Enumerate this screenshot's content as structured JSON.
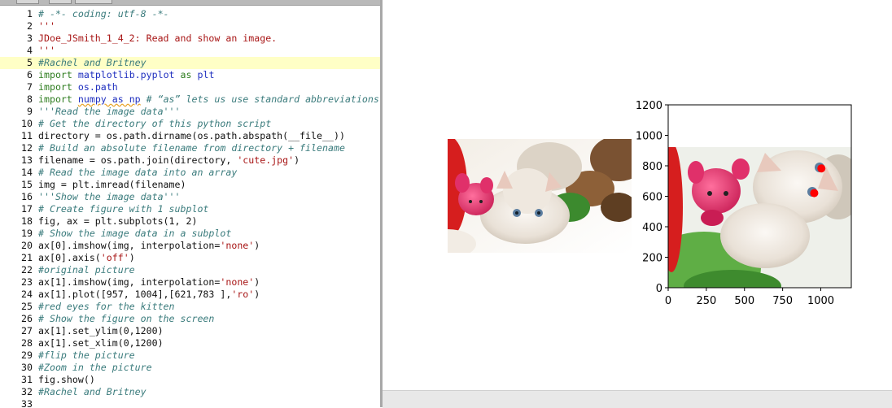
{
  "editor": {
    "highlighted_line": 5,
    "lines": [
      [
        {
          "c": "comment",
          "t": "# -*- coding: utf-8 -*-"
        }
      ],
      [
        {
          "c": "string",
          "t": "'''"
        }
      ],
      [
        {
          "c": "string",
          "t": "JDoe_JSmith_1_4_2: Read and show an image."
        }
      ],
      [
        {
          "c": "string",
          "t": "'''"
        }
      ],
      [
        {
          "c": "comment",
          "t": "#Rachel and Britney"
        }
      ],
      [
        {
          "c": "keyword",
          "t": "import"
        },
        {
          "c": "plain",
          "t": " "
        },
        {
          "c": "module",
          "t": "matplotlib.pyplot"
        },
        {
          "c": "plain",
          "t": " "
        },
        {
          "c": "keyword",
          "t": "as"
        },
        {
          "c": "plain",
          "t": " "
        },
        {
          "c": "module",
          "t": "plt"
        }
      ],
      [
        {
          "c": "keyword",
          "t": "import"
        },
        {
          "c": "plain",
          "t": " "
        },
        {
          "c": "module",
          "t": "os.path"
        }
      ],
      [
        {
          "c": "keyword",
          "t": "import"
        },
        {
          "c": "plain",
          "t": " "
        },
        {
          "c": "module squig",
          "t": "numpy as np"
        },
        {
          "c": "plain",
          "t": " "
        },
        {
          "c": "comment",
          "t": "# “as” lets us use standard abbreviations"
        }
      ],
      [
        {
          "c": "comment",
          "t": "'''Read the image data'''"
        }
      ],
      [
        {
          "c": "comment",
          "t": "# Get the directory of this python script"
        }
      ],
      [
        {
          "c": "plain",
          "t": "directory = os.path.dirname(os.path.abspath(__file__))"
        }
      ],
      [
        {
          "c": "comment",
          "t": "# Build an absolute filename from directory + filename"
        }
      ],
      [
        {
          "c": "plain",
          "t": "filename = os.path.join(directory, "
        },
        {
          "c": "string",
          "t": "'cute.jpg'"
        },
        {
          "c": "plain",
          "t": ")"
        }
      ],
      [
        {
          "c": "comment",
          "t": "# Read the image data into an array"
        }
      ],
      [
        {
          "c": "plain",
          "t": "img = plt.imread(filename)"
        }
      ],
      [
        {
          "c": "comment",
          "t": "'''Show the image data'''"
        }
      ],
      [
        {
          "c": "comment",
          "t": "# Create figure with 1 subplot"
        }
      ],
      [
        {
          "c": "plain",
          "t": "fig, ax = plt.subplots(1, 2)"
        }
      ],
      [
        {
          "c": "comment",
          "t": "# Show the image data in a subplot"
        }
      ],
      [
        {
          "c": "plain",
          "t": "ax[0].imshow(img, interpolation="
        },
        {
          "c": "string",
          "t": "'none'"
        },
        {
          "c": "plain",
          "t": ")"
        }
      ],
      [
        {
          "c": "plain",
          "t": "ax[0].axis("
        },
        {
          "c": "string",
          "t": "'off'"
        },
        {
          "c": "plain",
          "t": ")"
        }
      ],
      [
        {
          "c": "comment",
          "t": "#original picture"
        }
      ],
      [
        {
          "c": "plain",
          "t": "ax[1].imshow(img, interpolation="
        },
        {
          "c": "string",
          "t": "'none'"
        },
        {
          "c": "plain",
          "t": ")"
        }
      ],
      [
        {
          "c": "plain",
          "t": "ax[1].plot([957, 1004],[621,783 ],"
        },
        {
          "c": "string",
          "t": "'ro'"
        },
        {
          "c": "plain",
          "t": ")"
        }
      ],
      [
        {
          "c": "comment",
          "t": "#red eyes for the kitten"
        }
      ],
      [
        {
          "c": "comment",
          "t": "# Show the figure on the screen"
        }
      ],
      [
        {
          "c": "plain",
          "t": "ax[1].set_ylim(0,1200)"
        }
      ],
      [
        {
          "c": "plain",
          "t": "ax[1].set_xlim(0,1200)"
        }
      ],
      [
        {
          "c": "comment",
          "t": "#flip the picture"
        }
      ],
      [
        {
          "c": "comment",
          "t": "#Zoom in the picture"
        }
      ],
      [
        {
          "c": "plain",
          "t": "fig.show()"
        }
      ],
      [
        {
          "c": "comment",
          "t": "#Rachel and Britney"
        }
      ],
      []
    ]
  },
  "chart_data": [
    {
      "type": "image",
      "axis": "off",
      "description_image": "kitten with toys"
    },
    {
      "type": "scatter",
      "xlim": [
        0,
        1200
      ],
      "ylim": [
        0,
        1200
      ],
      "xticks": [
        0,
        250,
        500,
        750,
        1000
      ],
      "yticks": [
        0,
        200,
        400,
        600,
        800,
        1000,
        1200
      ],
      "xlabel": "",
      "ylabel": "",
      "title": "",
      "marker_color": "#ff0000",
      "points": [
        {
          "x": 957,
          "y": 621
        },
        {
          "x": 1004,
          "y": 783
        }
      ]
    }
  ]
}
